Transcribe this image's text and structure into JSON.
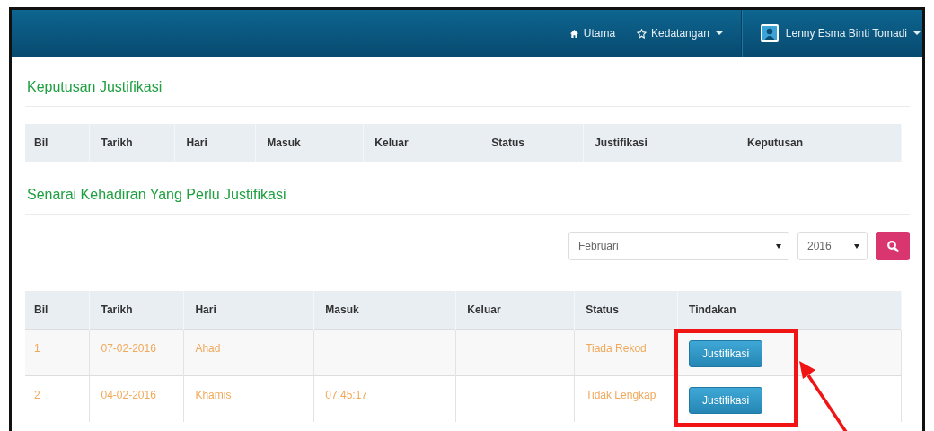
{
  "navbar": {
    "items": [
      {
        "kind": "home",
        "label": "Utama",
        "dropdown": false
      },
      {
        "kind": "attendance",
        "label": "Kedatangan",
        "dropdown": true
      }
    ],
    "user": {
      "name": "Lenny Esma Binti Tomadi",
      "dropdown": true
    }
  },
  "decisions": {
    "title": "Keputusan Justifikasi",
    "columns": [
      "Bil",
      "Tarikh",
      "Hari",
      "Masuk",
      "Keluar",
      "Status",
      "Justifikasi",
      "Keputusan"
    ]
  },
  "attendance": {
    "title": "Senarai Kehadiran Yang Perlu Justifikasi",
    "filters": {
      "month": "Februari",
      "year": "2016"
    },
    "columns": [
      "Bil",
      "Tarikh",
      "Hari",
      "Masuk",
      "Keluar",
      "Status",
      "Tindakan"
    ],
    "rows": [
      {
        "bil": "1",
        "tarikh": "07-02-2016",
        "hari": "Ahad",
        "status": "Tiada Rekod",
        "action": "Justifikasi"
      },
      {
        "bil": "2",
        "tarikh": "04-02-2016",
        "hari": "Khamis",
        "masuk": "07:45:17",
        "status": "Tidak Lengkap",
        "action": "Justifikasi"
      }
    ]
  }
}
